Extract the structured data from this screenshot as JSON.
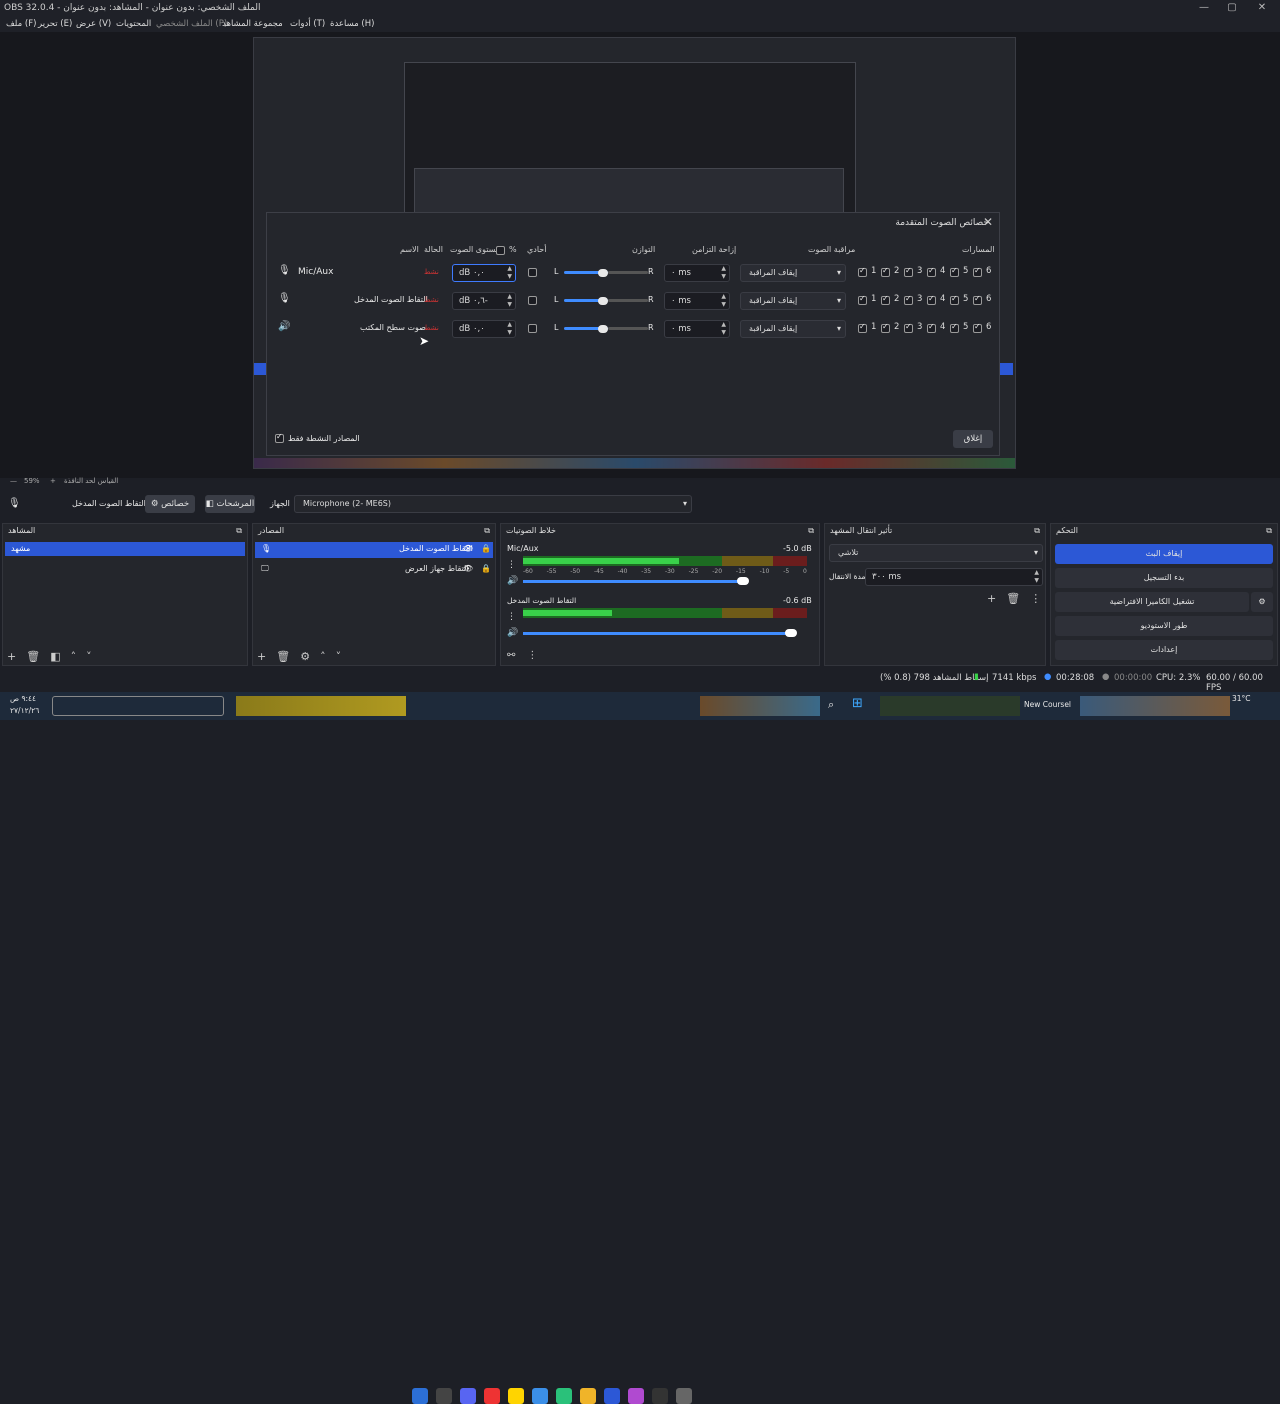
{
  "window": {
    "title": "OBS 32.0.4 - الملف الشخصي: بدون عنوان - المشاهد: بدون عنوان",
    "controls": [
      "—",
      "▢",
      "✕"
    ]
  },
  "menu": [
    "ملف (F)",
    "تحرير (E)",
    "عرض (V)",
    "المحتويات",
    "الملف الشخصي (P)",
    "مجموعة المشاهد",
    "أدوات (T)",
    "مساعدة (H)"
  ],
  "dialog": {
    "title": "خصائص الصوت المتقدمة",
    "headers": {
      "name": "الاسم",
      "status": "الحالة",
      "volume": "مستوى الصوت",
      "percent": "%",
      "mono": "أحادي",
      "balance": "التوازن",
      "sync": "إزاحة التزامن",
      "monitoring": "مراقبة الصوت",
      "tracks": "المسارات"
    },
    "rows": [
      {
        "name": "Mic/Aux",
        "status": "نشط",
        "volume": "dB ٠,٠",
        "sync": "٠ ms",
        "monitoring": "إيقاف المراقبة",
        "icon": "mic-icon"
      },
      {
        "name": "التقاط الصوت المدخل",
        "status": "نشط",
        "volume": "dB ٠,٦-",
        "sync": "٠ ms",
        "monitoring": "إيقاف المراقبة",
        "icon": "mic-icon"
      },
      {
        "name": "صوت سطح المكتب",
        "status": "نشط",
        "volume": "dB ٠,٠",
        "sync": "٠ ms",
        "monitoring": "إيقاف المراقبة",
        "icon": "speaker-icon"
      }
    ],
    "balance_left": "L",
    "balance_right": "R",
    "track_labels": [
      "1",
      "2",
      "3",
      "4",
      "5",
      "6"
    ],
    "active_only": "المصادر النشطة فقط",
    "close": "إغلاق"
  },
  "zoom": {
    "value": "59%",
    "label": "القياس لحد النافذة"
  },
  "source_toolbar": {
    "mic_label": "التقاط الصوت المدخل",
    "properties": "خصائص",
    "filters": "المرشحات",
    "device_label": "الجهاز",
    "device_value": "Microphone (2- ME6S)"
  },
  "scenes": {
    "title": "المشاهد",
    "items": [
      "مشهد"
    ]
  },
  "sources": {
    "title": "المصادر",
    "items": [
      "التقاط الصوت المدخل",
      "التقاط جهاز العرض"
    ]
  },
  "mixer": {
    "title": "خلاط الصوتيات",
    "channels": [
      {
        "name": "Mic/Aux",
        "db": "-5.0 dB",
        "level": 0.55
      },
      {
        "name": "التقاط الصوت المدخل",
        "db": "-0.6 dB",
        "level": 0.9
      }
    ],
    "scale": [
      "-60",
      "-55",
      "-50",
      "-45",
      "-40",
      "-35",
      "-30",
      "-25",
      "-20",
      "-15",
      "-10",
      "-5",
      "0"
    ]
  },
  "transitions": {
    "title": "تأثير انتقال المشهد",
    "type": "تلاشي",
    "duration_label": "مدة الانتقال",
    "duration": "٣٠٠ ms"
  },
  "controls": {
    "title": "التحكم",
    "buttons": [
      "إيقاف البث",
      "بدء التسجيل",
      "تشغيل الكاميرا الافتراضية",
      "طور الاستوديو",
      "إعدادات"
    ]
  },
  "status": {
    "dropped": "إسقاط المشاهد 798 (0.8 %)",
    "bitrate": "7141 kbps",
    "stream_time": "00:28:08",
    "rec_time": "00:00:00",
    "cpu": "CPU: 2.3%",
    "fps": "60.00 / 60.00 FPS"
  },
  "taskbar": {
    "time": "٩:٤٤ ص",
    "date": "٢٧/١٢/٢٦",
    "temp": "31°C",
    "course": "New Coursel"
  }
}
